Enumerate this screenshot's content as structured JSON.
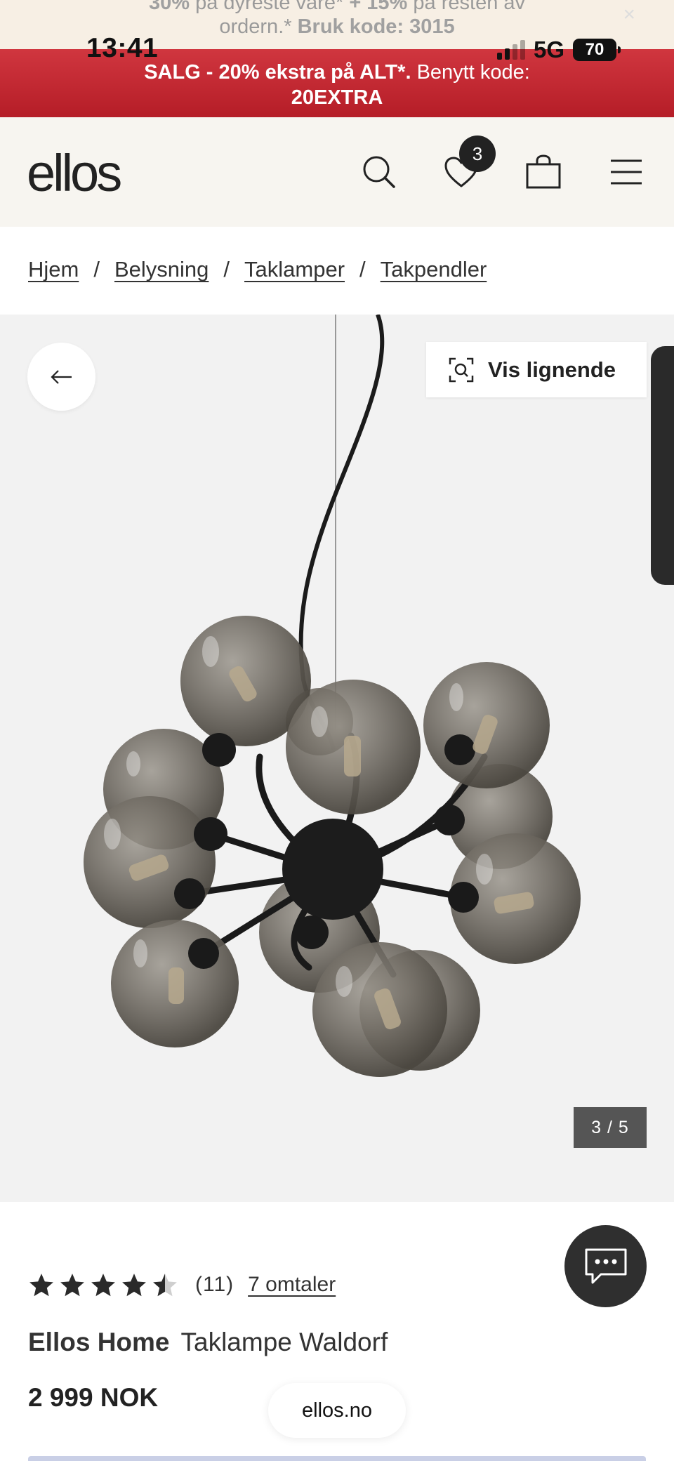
{
  "promo_top": {
    "line1_a": "30%",
    "line1_b": " på dyreste vare* ",
    "line1_c": "+ 15%",
    "line1_d": " på resten av",
    "line2_a": "ordern.* ",
    "line2_b": "Bruk kode: 3015",
    "close_glyph": "×"
  },
  "sale_banner": {
    "line1_bold": "SALG - 20% ekstra på ALT*.",
    "line1_rest": " Benytt kode:",
    "code": "20EXTRA"
  },
  "status_bar": {
    "time": "13:41",
    "network": "5G",
    "battery": "70"
  },
  "header": {
    "logo": "ellos",
    "wishlist_count": "3"
  },
  "breadcrumb": {
    "items": [
      "Hjem",
      "Belysning",
      "Taklamper",
      "Takpendler"
    ],
    "separator": "/"
  },
  "gallery": {
    "similar_label": "Vis lignende",
    "counter": "3 / 5",
    "current": 3,
    "total": 5
  },
  "product": {
    "rating": 4.5,
    "review_count": "(11)",
    "reviews_link": "7 omtaler",
    "brand": "Ellos Home",
    "name": "Taklampe Waldorf",
    "price": "2 999 NOK"
  },
  "browser": {
    "url": "ellos.no"
  },
  "colors": {
    "sale_red": "#c22a33",
    "header_bg": "#f7f5f0",
    "gallery_bg": "#f2f2f2"
  }
}
